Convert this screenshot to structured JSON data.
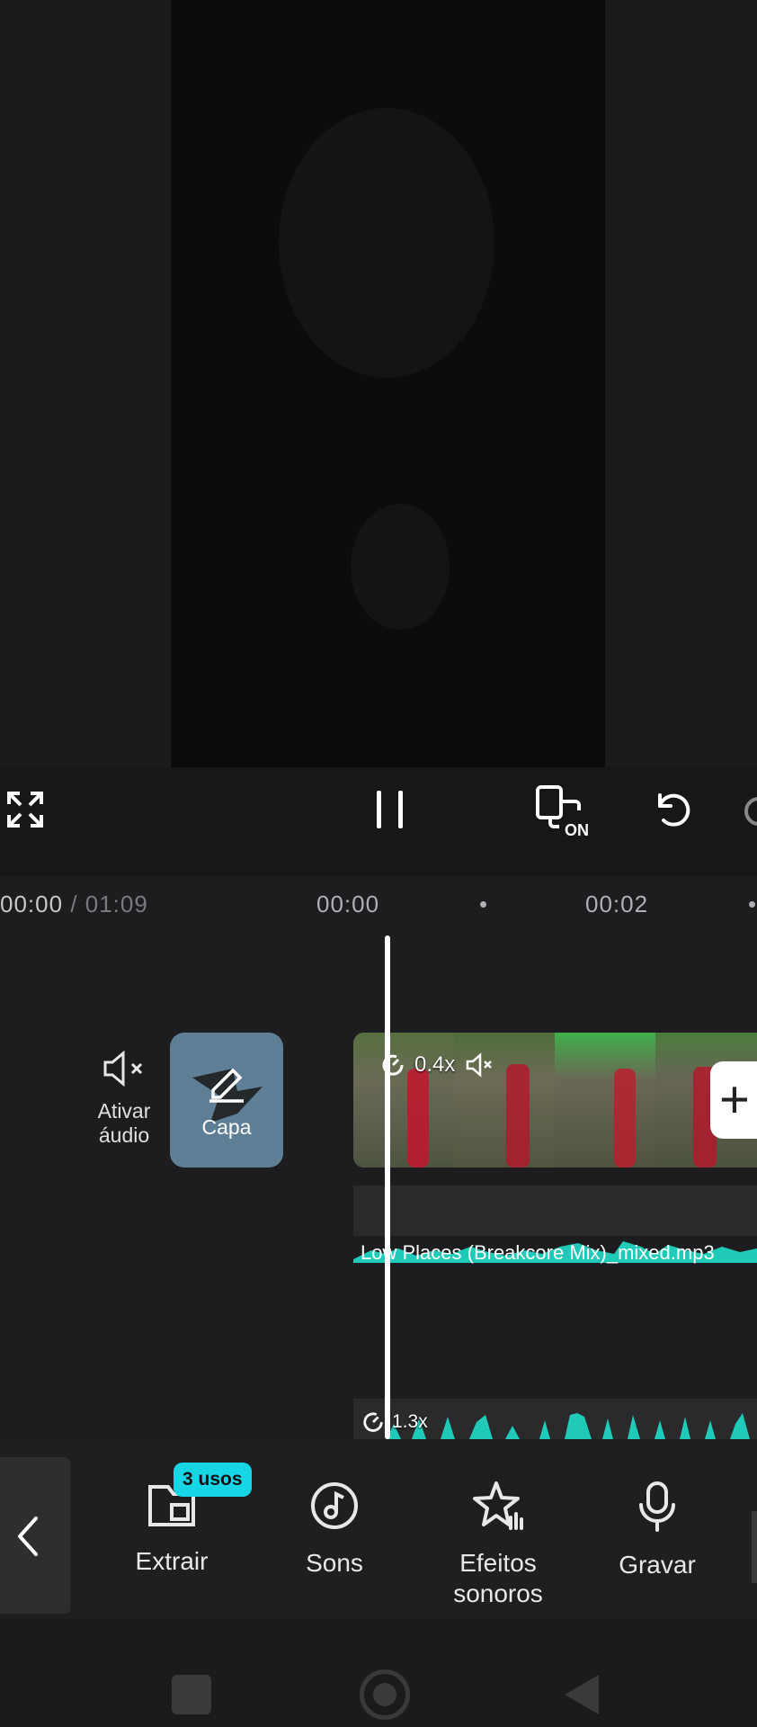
{
  "controls": {
    "icons": [
      "fullscreen-icon",
      "pause-icon",
      "screen-mirror-on-icon",
      "undo-icon",
      "redo-icon"
    ],
    "mirror_badge": "ON"
  },
  "timeline": {
    "current_time": "00:00",
    "total_time": "/ 01:09",
    "ruler_ticks": [
      "00:00",
      "•",
      "00:02",
      "•"
    ]
  },
  "track_controls": {
    "mute_label": "Ativar áudio",
    "cover_label": "Capa"
  },
  "video_clip": {
    "speed": "0.4x"
  },
  "music_track": {
    "file_name": "Low Places (Breakcore Mix)_mixed.mp3"
  },
  "secondary_track": {
    "speed": "1.3x"
  },
  "toolbar": {
    "usage_badge": "3 usos",
    "items": [
      {
        "label": "Extrair",
        "icon": "extract-icon"
      },
      {
        "label": "Sons",
        "icon": "music-note-icon"
      },
      {
        "label": "Efeitos sonoros",
        "icon": "star-sound-icon"
      },
      {
        "label": "Gravar",
        "icon": "microphone-icon"
      }
    ]
  },
  "colors": {
    "accent": "#16d6e6",
    "waveform": "#1fcbb8",
    "background": "#1c1c1e"
  }
}
